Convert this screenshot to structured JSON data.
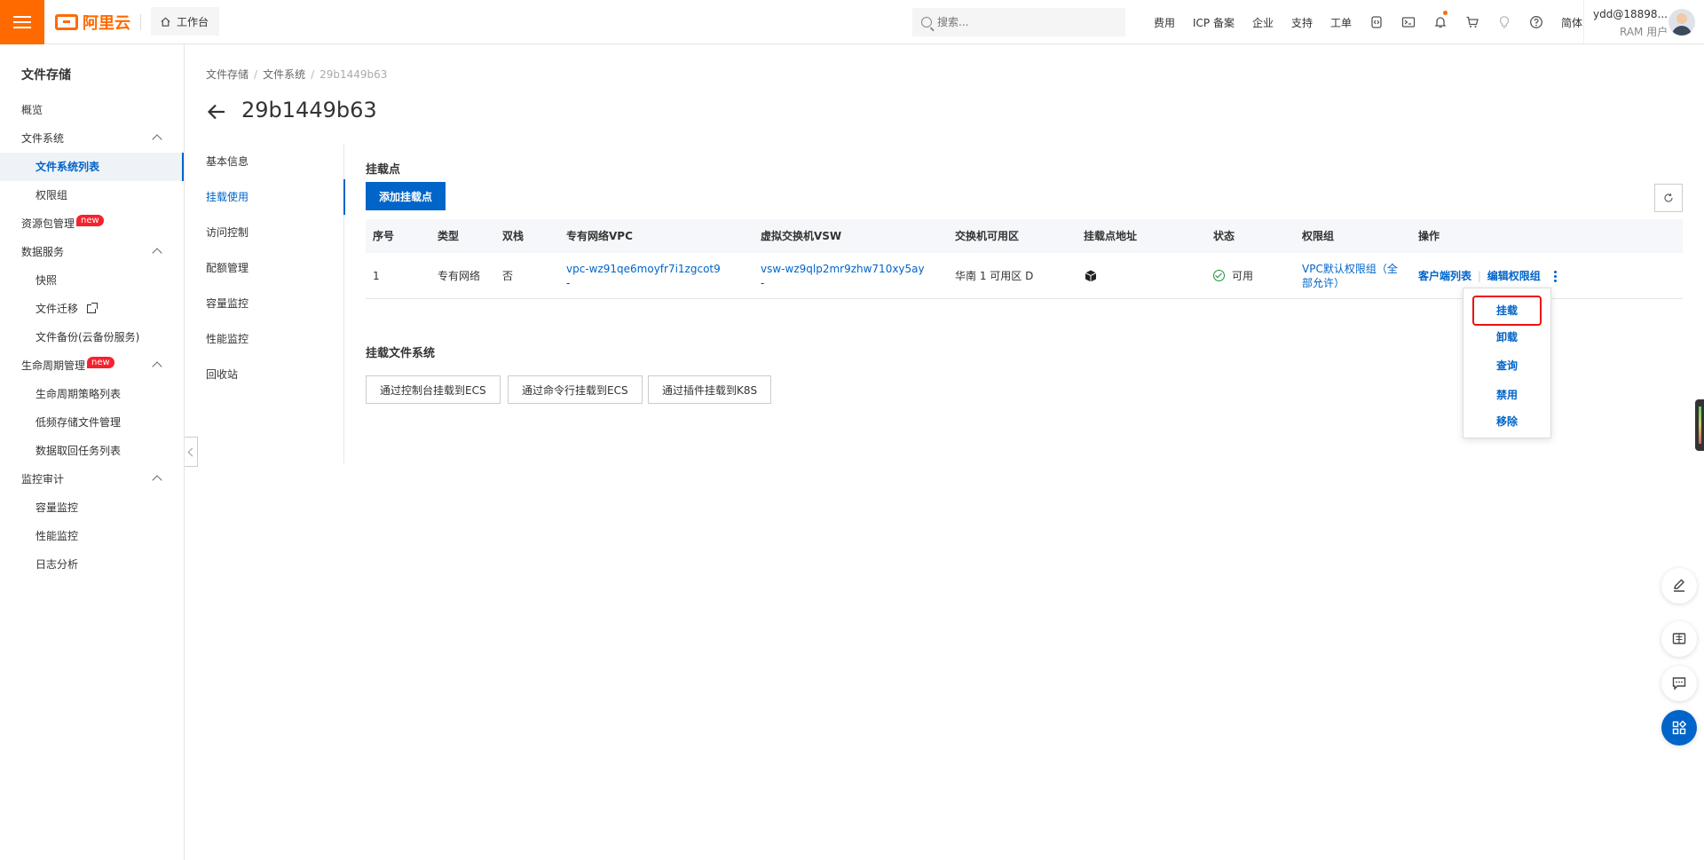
{
  "header": {
    "logo_text": "阿里云",
    "workbench_label": "工作台",
    "search_placeholder": "搜索...",
    "nav": [
      "费用",
      "ICP 备案",
      "企业",
      "支持",
      "工单"
    ],
    "lang": "简体",
    "user_name": "ydd@18898...",
    "user_role": "RAM 用户",
    "accent": "#ff6a00"
  },
  "sidebar": {
    "title": "文件存储",
    "items": [
      {
        "label": "概览"
      },
      {
        "label": "文件系统"
      },
      {
        "label": "文件系统列表"
      },
      {
        "label": "权限组"
      },
      {
        "label": "资源包管理",
        "badge": "new"
      },
      {
        "label": "数据服务"
      },
      {
        "label": "快照"
      },
      {
        "label": "文件迁移"
      },
      {
        "label": "文件备份(云备份服务)"
      },
      {
        "label": "生命周期管理",
        "badge": "new"
      },
      {
        "label": "生命周期策略列表"
      },
      {
        "label": "低频存储文件管理"
      },
      {
        "label": "数据取回任务列表"
      },
      {
        "label": "监控审计"
      },
      {
        "label": "容量监控"
      },
      {
        "label": "性能监控"
      },
      {
        "label": "日志分析"
      }
    ]
  },
  "breadcrumb": [
    "文件存储",
    "文件系统",
    "29b1449b63"
  ],
  "page_title": "29b1449b63",
  "subnav": [
    "基本信息",
    "挂载使用",
    "访问控制",
    "配额管理",
    "容量监控",
    "性能监控",
    "回收站"
  ],
  "mount_section": {
    "title": "挂载点",
    "add_button": "添加挂载点",
    "columns": [
      "序号",
      "类型",
      "双栈",
      "专有网络VPC",
      "虚拟交换机VSW",
      "交换机可用区",
      "挂载点地址",
      "状态",
      "权限组",
      "操作"
    ],
    "rows": [
      {
        "index": "1",
        "type": "专有网络",
        "dual_stack": "否",
        "vpc": "vpc-wz91qe6moyfr7i1zgcot9",
        "vpc_sub": "-",
        "vsw": "vsw-wz9qlp2mr9zhw710xy5ay",
        "vsw_sub": "-",
        "zone": "华南 1 可用区 D",
        "status": "可用",
        "perm_line1": "VPC默认权限组（全",
        "perm_line2": "部允许）",
        "op_clients": "客户端列表",
        "op_edit": "编辑权限组"
      }
    ],
    "status_color": "#1e8e3e"
  },
  "dropdown": [
    "挂载",
    "卸载",
    "查询",
    "禁用",
    "移除"
  ],
  "mount_fs_section": {
    "title": "挂载文件系统",
    "buttons": [
      "通过控制台挂载到ECS",
      "通过命令行挂载到ECS",
      "通过插件挂载到K8S"
    ]
  }
}
